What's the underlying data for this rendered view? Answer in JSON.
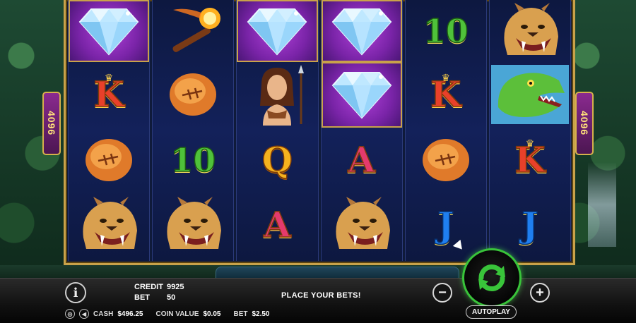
{
  "side_badges": {
    "left_ways": "4096",
    "right_ways": "4096"
  },
  "reels": [
    [
      "diamond",
      "K",
      "amber",
      "cat"
    ],
    [
      "torch",
      "amber",
      "10",
      "cat"
    ],
    [
      "diamond",
      "cavewoman",
      "Q",
      "A"
    ],
    [
      "diamond",
      "diamond",
      "A",
      "cat"
    ],
    [
      "10",
      "K",
      "amber",
      "J"
    ],
    [
      "cat",
      "dino",
      "K",
      "J"
    ]
  ],
  "status": {
    "credit_label": "CREDIT",
    "credit_value": "9925",
    "bet_label": "BET",
    "bet_value": "50",
    "message": "PLACE YOUR BETS!"
  },
  "footer": {
    "cash_label": "CASH",
    "cash_value": "$496.25",
    "coin_value_label": "COIN VALUE",
    "coin_value": "$0.05",
    "bet_label": "BET",
    "bet_value": "$2.50"
  },
  "controls": {
    "info_label": "i",
    "minus_label": "−",
    "plus_label": "+",
    "autoplay_label": "AUTOPLAY",
    "spin_icon": "refresh-arrows-icon",
    "spin_color": "#39c43a"
  },
  "colors": {
    "frame_gold": "#c9a24a",
    "reel_bg": "#13215a",
    "highlight_purple": "#9a35c8"
  }
}
